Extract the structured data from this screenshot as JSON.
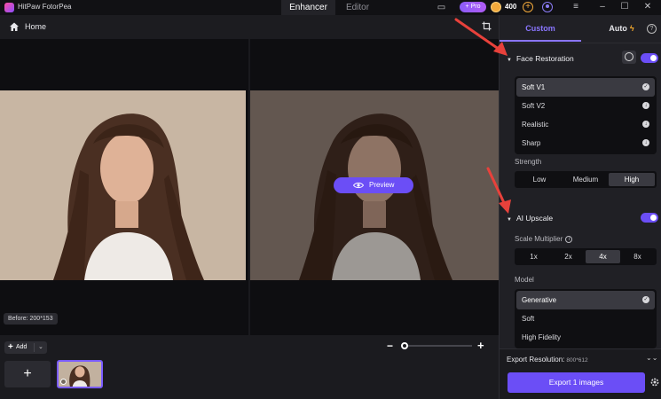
{
  "app": {
    "name": "HitPaw FotorPea"
  },
  "top_tabs": [
    {
      "label": "Enhancer",
      "active": true
    },
    {
      "label": "Editor",
      "active": false
    }
  ],
  "account": {
    "pro_label": "+ Pro",
    "coins": "400"
  },
  "home": {
    "label": "Home"
  },
  "canvas": {
    "preview_label": "Preview",
    "before_label": "Before: 200*153"
  },
  "bottom": {
    "add_label": "Add",
    "add_tile": "+"
  },
  "panel": {
    "tabs": {
      "custom": "Custom",
      "auto": "Auto"
    },
    "face_restoration": {
      "title": "Face Restoration",
      "enabled": true,
      "models": [
        {
          "label": "Soft V1",
          "selected": true
        },
        {
          "label": "Soft V2",
          "selected": false
        },
        {
          "label": "Realistic",
          "selected": false
        },
        {
          "label": "Sharp",
          "selected": false
        }
      ],
      "strength_label": "Strength",
      "strength_options": [
        "Low",
        "Medium",
        "High"
      ],
      "strength_selected": "High"
    },
    "ai_upscale": {
      "title": "AI Upscale",
      "enabled": true,
      "scale_label": "Scale Multiplier",
      "scale_options": [
        "1x",
        "2x",
        "4x",
        "8x"
      ],
      "scale_selected": "4x",
      "model_label": "Model",
      "models": [
        {
          "label": "Generative",
          "selected": true
        },
        {
          "label": "Soft",
          "selected": false
        },
        {
          "label": "High Fidelity",
          "selected": false
        }
      ]
    },
    "export": {
      "resolution_label": "Export Resolution:",
      "resolution_value": "800*612",
      "button_label": "Export 1 images"
    }
  },
  "colors": {
    "accent": "#6b4ef6",
    "arrow": "#e8413b",
    "coin": "#f2a93b"
  }
}
